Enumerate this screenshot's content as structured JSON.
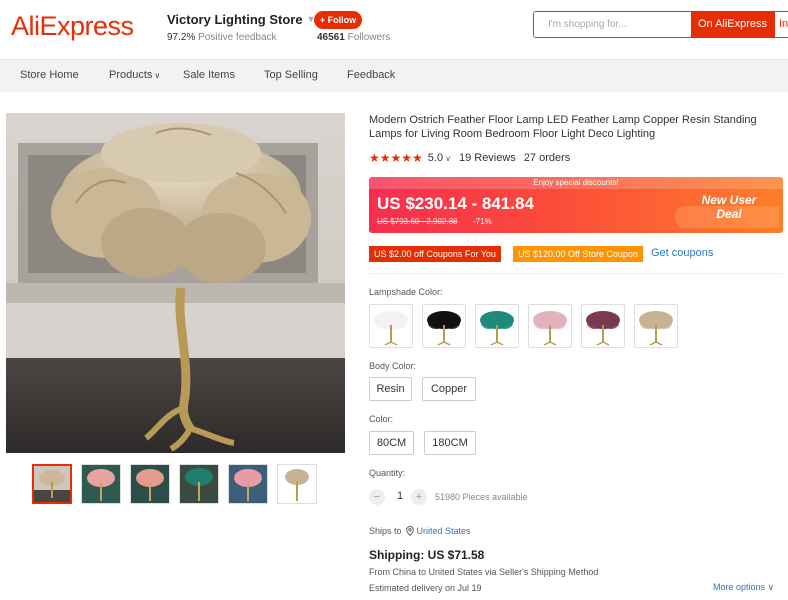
{
  "header": {
    "logo_text": "AliExpress",
    "store_name": "Victory Lighting Store",
    "feedback_pct": "97.2%",
    "feedback_label": "Positive feedback",
    "follow_label": "+ Follow",
    "followers_count": "46561",
    "followers_label": "Followers",
    "search_placeholder": "I'm shopping for...",
    "search_button": "On AliExpress",
    "search_button2": "In"
  },
  "nav": {
    "items": [
      "Store Home",
      "Products",
      "Sale Items",
      "Top Selling",
      "Feedback"
    ]
  },
  "product": {
    "title": "Modern Ostrich Feather Floor Lamp LED Feather Lamp Copper Resin Standing Lamps for Living Room Bedroom Floor Light Deco Lighting",
    "stars": "★★★★★",
    "rating": "5.0",
    "reviews": "19 Reviews",
    "orders": "27 orders",
    "discount_banner": "Enjoy special discounts!",
    "price": "US $230.14 - 841.84",
    "original_price": "US $793.60 - 2,902.88",
    "discount_pct": "-71%",
    "new_user_deal_line1": "New User",
    "new_user_deal_line2": "Deal",
    "coupon1": "US $2.00 off Coupons For You",
    "coupon2": "US $120.00 Off Store Coupon",
    "get_coupons": "Get coupons",
    "lampshade_label": "Lampshade Color:",
    "lampshade_colors": [
      "#f2f2f2",
      "#111111",
      "#1e8a7c",
      "#e3b3bd",
      "#7a3b4d",
      "#c7b394"
    ],
    "body_color_label": "Body Color:",
    "body_options": [
      "Resin",
      "Copper"
    ],
    "color_label": "Color:",
    "color_options": [
      "80CM",
      "180CM"
    ],
    "quantity_label": "Quantity:",
    "quantity": "1",
    "minus": "−",
    "plus": "+",
    "pieces_available": "51980 Pieces available",
    "ships_to_label": "Ships to",
    "ships_to_country": "United States",
    "shipping_cost": "Shipping: US $71.58",
    "ship_from": "From China to United States via Seller's Shipping Method",
    "est_delivery": "Estimated delivery on Jul 19",
    "more_options": "More options"
  },
  "colors": {
    "brand": "#e62e04",
    "link": "#2e74c7",
    "coupon_orange": "#fc9403"
  }
}
